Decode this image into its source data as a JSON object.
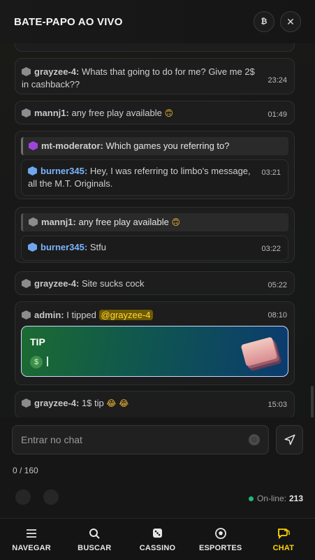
{
  "header": {
    "title": "BATE-PAPO AO VIVO",
    "rules_button": "rules-icon",
    "close_button": "close-icon"
  },
  "messages": [
    {
      "user": "grayzee-4:",
      "text": "Whats that going to do for me? Give me 2$ in cashback??",
      "time": "23:24"
    },
    {
      "user": "mannj1:",
      "text": "any free play available",
      "emoji": "🙃",
      "time": "01:49"
    },
    {
      "quote_user": "mt-moderator:",
      "quote_text": "Which games you referring to?",
      "user": "burner345:",
      "text": "Hey, I was referring to limbo's message, all the M.T. Originals.",
      "time": "03:21"
    },
    {
      "quote_user": "mannj1:",
      "quote_text": "any free play available",
      "quote_emoji": "🙃",
      "user": "burner345:",
      "text": "Stfu",
      "time": "03:22"
    },
    {
      "user": "grayzee-4:",
      "text": "Site sucks cock",
      "time": "05:22"
    },
    {
      "user": "admin:",
      "text": "I tipped",
      "mention": "@grayzee-4",
      "time": "08:10",
      "tip_title": "TIP",
      "tip_coin": "$"
    },
    {
      "user": "grayzee-4:",
      "text": "1$ tip",
      "emoji": "😂 😂",
      "time": "15:03"
    }
  ],
  "composer": {
    "placeholder": "Entrar no chat",
    "counter": "0 / 160"
  },
  "online": {
    "label": "On-line:",
    "count": "213",
    "status_color": "#1fb979"
  },
  "nav": [
    {
      "label": "NAVEGAR",
      "icon": "menu-icon"
    },
    {
      "label": "BUSCAR",
      "icon": "search-icon"
    },
    {
      "label": "CASSINO",
      "icon": "dice-icon"
    },
    {
      "label": "ESPORTES",
      "icon": "soccer-ball-icon"
    },
    {
      "label": "CHAT",
      "icon": "chat-icon",
      "active": true
    }
  ],
  "accent_color": "#ffd400"
}
